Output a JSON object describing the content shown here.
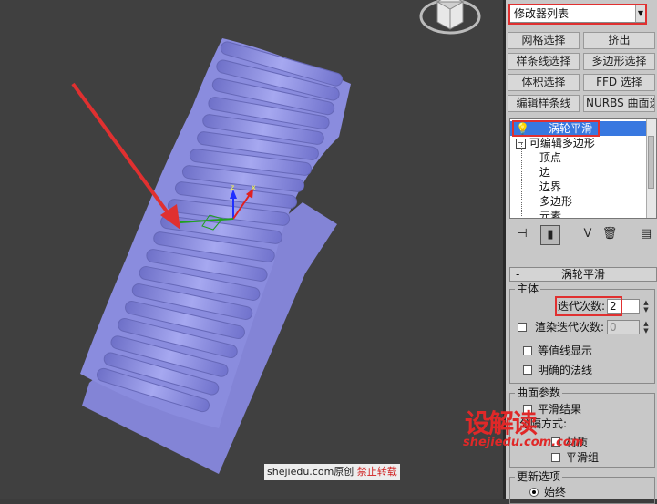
{
  "panel": {
    "modifier_list": "修改器列表",
    "buttons": [
      [
        "网格选择",
        "挤出"
      ],
      [
        "样条线选择",
        "多边形选择"
      ],
      [
        "体积选择",
        "FFD 选择"
      ],
      [
        "编辑样条线",
        "NURBS 曲面选择"
      ]
    ],
    "stack": {
      "top": "涡轮平滑",
      "base": "可编辑多边形",
      "subs": [
        "顶点",
        "边",
        "边界",
        "多边形",
        "元素"
      ]
    },
    "turbosmooth": {
      "title": "涡轮平滑",
      "main_group": "主体",
      "iterations_label": "迭代次数:",
      "iterations_value": "2",
      "render_iters_label": "渲染迭代次数:",
      "render_iters_value": "0",
      "isoline_label": "等值线显示",
      "explicit_normals_label": "明确的法线",
      "surface_group": "曲面参数",
      "smooth_result_label": "平滑结果",
      "separate_by_label": "分隔方式:",
      "materials_label": "材质",
      "smoothing_groups_label": "平滑组",
      "update_group": "更新选项",
      "always_label": "始终"
    }
  },
  "icons": [
    "light-bulb-icon",
    "pin-stack-icon",
    "show-end-result-icon",
    "make-unique-icon",
    "remove-modifier-icon",
    "configure-sets-icon",
    "viewcube-icon"
  ],
  "watermark": {
    "logo": "设解读",
    "url": "shejiedu.com.com",
    "credit_prefix": "shejiedu.com原创",
    "credit_suffix": "禁止转载"
  },
  "colors": {
    "model": "#8c8ee0",
    "highlight": "#3878e0",
    "annotation": "#e03030"
  }
}
